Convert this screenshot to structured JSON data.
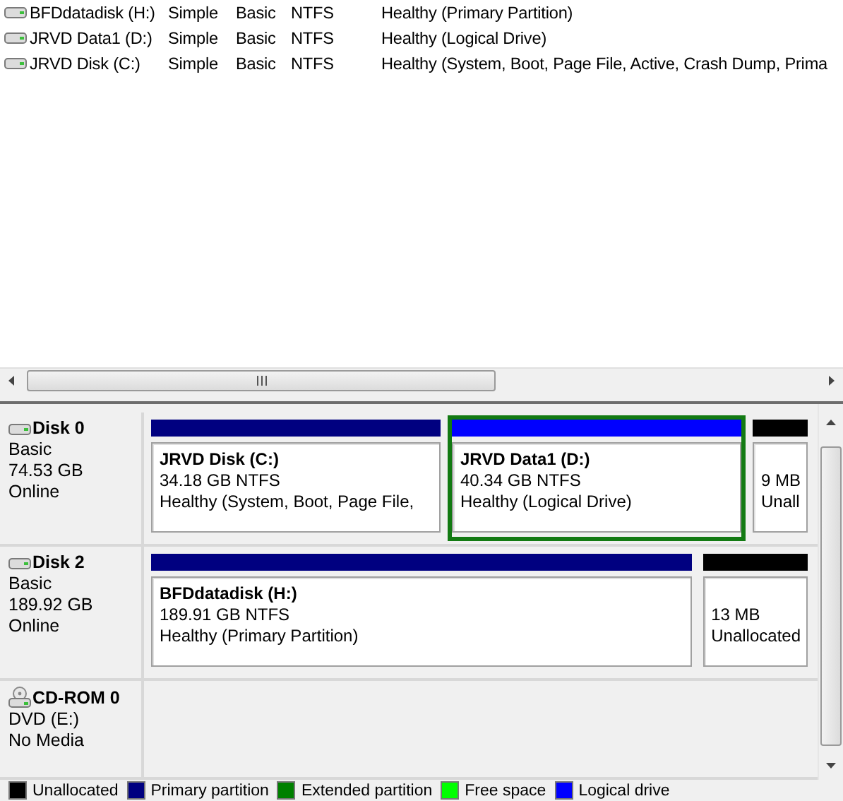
{
  "volumes": [
    {
      "name": "BFDdatadisk (H:)",
      "layout": "Simple",
      "type": "Basic",
      "file_system": "NTFS",
      "status": "Healthy (Primary Partition)"
    },
    {
      "name": "JRVD Data1 (D:)",
      "layout": "Simple",
      "type": "Basic",
      "file_system": "NTFS",
      "status": "Healthy (Logical Drive)"
    },
    {
      "name": "JRVD Disk (C:)",
      "layout": "Simple",
      "type": "Basic",
      "file_system": "NTFS",
      "status": "Healthy (System, Boot, Page File, Active, Crash Dump, Prima"
    }
  ],
  "disks": [
    {
      "name": "Disk 0",
      "kind": "disk",
      "details": [
        "Basic",
        "74.53 GB",
        "Online"
      ],
      "partitions": [
        {
          "kind": "primary",
          "selected": false,
          "title": "JRVD Disk  (C:)",
          "size": "34.18 GB NTFS",
          "status": "Healthy (System, Boot, Page File,"
        },
        {
          "kind": "logical",
          "selected": true,
          "title": "JRVD Data1  (D:)",
          "size": "40.34 GB NTFS",
          "status": "Healthy (Logical Drive)"
        },
        {
          "kind": "unallocated",
          "selected": false,
          "size": "9 MB",
          "status": "Unall"
        }
      ]
    },
    {
      "name": "Disk 2",
      "kind": "disk",
      "details": [
        "Basic",
        "189.92 GB",
        "Online"
      ],
      "partitions": [
        {
          "kind": "primary",
          "selected": false,
          "title": "BFDdatadisk  (H:)",
          "size": "189.91 GB NTFS",
          "status": "Healthy (Primary Partition)"
        },
        {
          "kind": "unallocated",
          "selected": false,
          "size": "13 MB",
          "status": "Unallocated"
        }
      ]
    },
    {
      "name": "CD-ROM 0",
      "kind": "cdrom",
      "details": [
        "DVD (E:)",
        "No Media"
      ]
    }
  ],
  "legend": [
    {
      "label": "Unallocated",
      "color": "#000000"
    },
    {
      "label": "Primary partition",
      "color": "#000080"
    },
    {
      "label": "Extended partition",
      "color": "#008000"
    },
    {
      "label": "Free space",
      "color": "#00ff00"
    },
    {
      "label": "Logical drive",
      "color": "#0000ff"
    }
  ]
}
